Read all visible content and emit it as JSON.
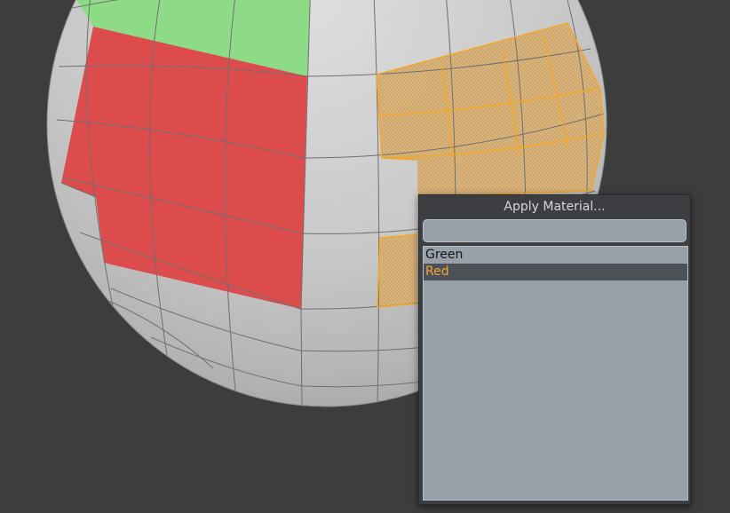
{
  "viewport": {
    "background_color": "#3d3d3d",
    "mesh_color": "#c8c8c8",
    "material_colors": {
      "Green": "#8edb87",
      "Red": "#dd4c4c",
      "selection": "#f5a623"
    }
  },
  "popup": {
    "title": "Apply Material...",
    "filter": {
      "value": "",
      "placeholder": ""
    },
    "items": [
      {
        "label": "Green",
        "selected": false
      },
      {
        "label": "Red",
        "selected": true
      }
    ]
  }
}
